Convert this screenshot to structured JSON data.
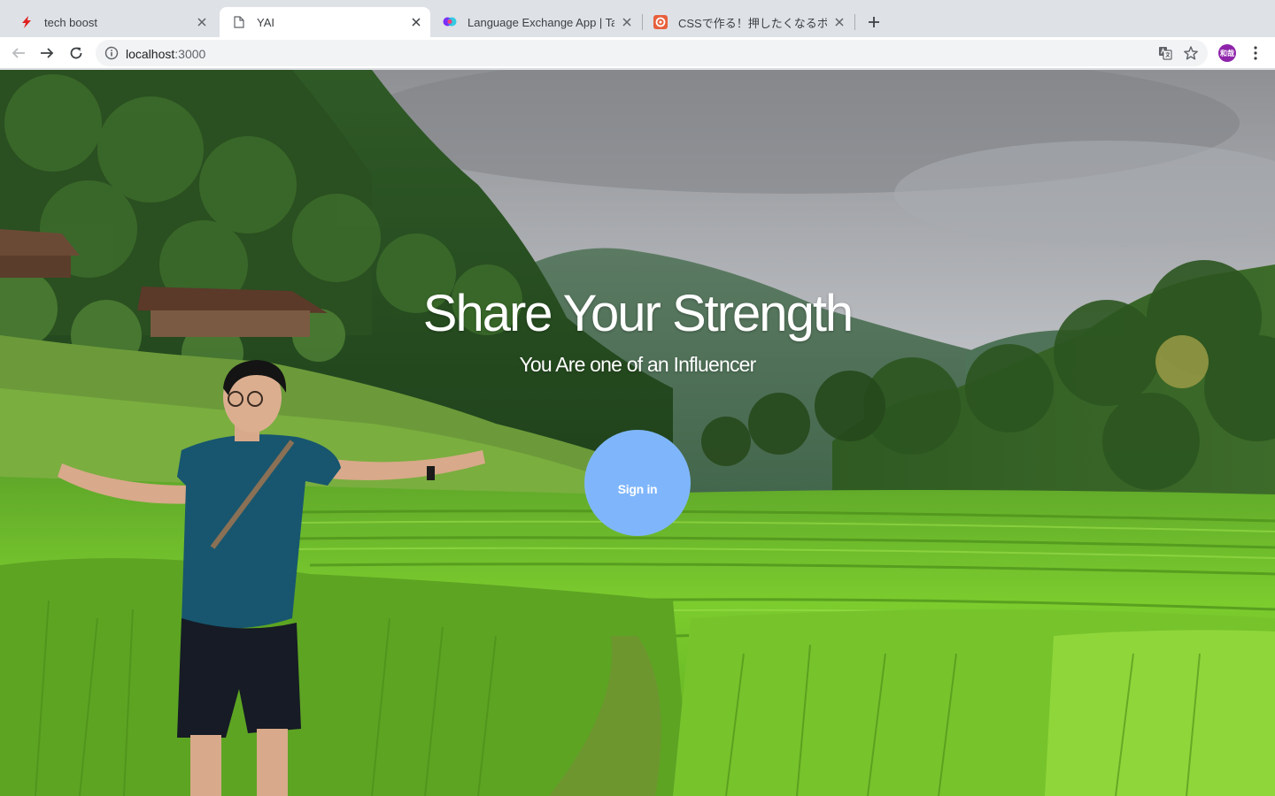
{
  "browser": {
    "tabs": [
      {
        "title": "tech boost",
        "icon": "lightning-favicon-icon",
        "active": false
      },
      {
        "title": "YAI",
        "icon": "page-favicon-icon",
        "active": true
      },
      {
        "title": "Language Exchange App | Tandem",
        "icon": "tandem-favicon-icon",
        "active": false
      },
      {
        "title": "CSSで作る！押したくなるボタンデザイン",
        "icon": "ics-favicon-icon",
        "active": false
      }
    ],
    "url_host": "localhost",
    "url_port": ":3000",
    "profile_initials": "和哉",
    "colors": {
      "tabstrip": "#dee1e6",
      "profile": "#8e24aa",
      "techboost_icon": "#e02020"
    }
  },
  "page": {
    "headline": "Share Your Strength",
    "subheadline": "You Are one of an Influencer",
    "signin_label": "Sign in",
    "colors": {
      "button": "#7fb6fb",
      "text": "#ffffff"
    },
    "background_description": "rice terraces and forested mountains under cloudy sky, man with outstretched arms"
  }
}
